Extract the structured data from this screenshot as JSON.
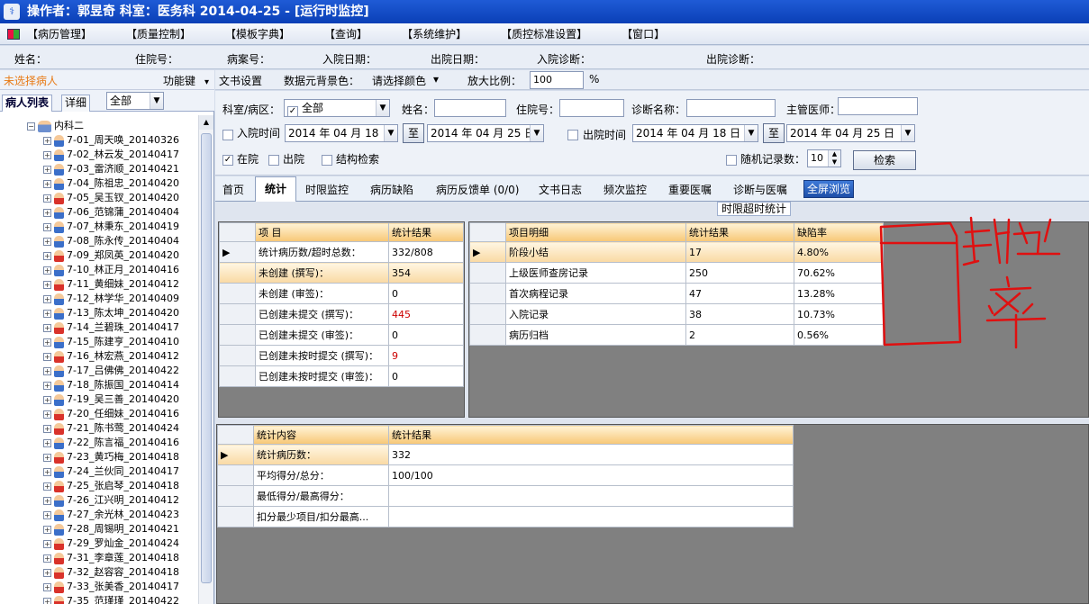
{
  "window": {
    "title": "操作者：郭昱奇    科室：医务科    2014-04-25 - [运行时监控]"
  },
  "menu": {
    "items": [
      "【病历管理】",
      "【质量控制】",
      "【模板字典】",
      "【查询】",
      "【系统维护】",
      "【质控标准设置】",
      "【窗口】"
    ]
  },
  "patient_info": {
    "name": "姓名：",
    "hosp_no": "住院号：",
    "case_no": "病案号：",
    "admit_date": "入院日期：",
    "discharge_date": "出院日期：",
    "admit_diag": "入院诊断：",
    "discharge_diag": "出院诊断："
  },
  "left_panel": {
    "no_patient": "未选择病人",
    "function_key": "功能键",
    "tab_list": "病人列表",
    "tab_detail": "详细",
    "filter_value": "全部",
    "root": "内科二",
    "patients": [
      {
        "label": "7-01_周天唤_20140326",
        "g": "m"
      },
      {
        "label": "7-02_林云发_20140417",
        "g": "m"
      },
      {
        "label": "7-03_雷济顺_20140421",
        "g": "m"
      },
      {
        "label": "7-04_陈祖忠_20140420",
        "g": "m"
      },
      {
        "label": "7-05_吴玉钗_20140420",
        "g": "f"
      },
      {
        "label": "7-06_范锦蒲_20140404",
        "g": "m"
      },
      {
        "label": "7-07_林秉东_20140419",
        "g": "m"
      },
      {
        "label": "7-08_陈永传_20140404",
        "g": "m"
      },
      {
        "label": "7-09_郑凤英_20140420",
        "g": "f"
      },
      {
        "label": "7-10_林正月_20140416",
        "g": "m"
      },
      {
        "label": "7-11_黄细妹_20140412",
        "g": "f"
      },
      {
        "label": "7-12_林学华_20140409",
        "g": "m"
      },
      {
        "label": "7-13_陈太坤_20140420",
        "g": "m"
      },
      {
        "label": "7-14_兰碧珠_20140417",
        "g": "f"
      },
      {
        "label": "7-15_陈建亨_20140410",
        "g": "m"
      },
      {
        "label": "7-16_林宏燕_20140412",
        "g": "f"
      },
      {
        "label": "7-17_吕佛佛_20140422",
        "g": "m"
      },
      {
        "label": "7-18_陈振国_20140414",
        "g": "m"
      },
      {
        "label": "7-19_吴三善_20140420",
        "g": "m"
      },
      {
        "label": "7-20_任细妹_20140416",
        "g": "f"
      },
      {
        "label": "7-21_陈书莺_20140424",
        "g": "f"
      },
      {
        "label": "7-22_陈言福_20140416",
        "g": "m"
      },
      {
        "label": "7-23_黄巧梅_20140418",
        "g": "f"
      },
      {
        "label": "7-24_兰伙同_20140417",
        "g": "m"
      },
      {
        "label": "7-25_张启琴_20140418",
        "g": "f"
      },
      {
        "label": "7-26_江兴明_20140412",
        "g": "m"
      },
      {
        "label": "7-27_余光林_20140423",
        "g": "m"
      },
      {
        "label": "7-28_周锡明_20140421",
        "g": "m"
      },
      {
        "label": "7-29_罗灿金_20140424",
        "g": "f"
      },
      {
        "label": "7-31_李章莲_20140418",
        "g": "f"
      },
      {
        "label": "7-32_赵容容_20140418",
        "g": "f"
      },
      {
        "label": "7-33_张美香_20140417",
        "g": "f"
      },
      {
        "label": "7-35_范瑾瑾_20140422",
        "g": "f"
      }
    ]
  },
  "toolbar": {
    "doc_settings": "文书设置",
    "bg_color_label": "数据元背景色：",
    "bg_color_value": "请选择颜色",
    "zoom_label": "放大比例：",
    "zoom_value": "100",
    "zoom_unit": "%"
  },
  "filter": {
    "dept_label": "科室/病区：",
    "dept_value": "全部",
    "name_label": "姓名：",
    "hosp_no_label": "住院号：",
    "diag_label": "诊断名称：",
    "doctor_label": "主管医师：",
    "admit_time_label": "入院时间",
    "admit_from": "2014 年 04 月 18 日",
    "to1": "至",
    "admit_to": "2014 年 04 月 25 日",
    "discharge_time_label": "出院时间",
    "discharge_from": "2014 年 04 月 18 日",
    "to2": "至",
    "discharge_to": "2014 年 04 月 25 日",
    "in_hosp": "在院",
    "out_hosp": "出院",
    "struct_search": "结构检索",
    "random_label": "随机记录数：",
    "random_value": "10",
    "search_button": "检索"
  },
  "tabs": [
    "首页",
    "统计",
    "时限监控",
    "病历缺陷",
    "病历反馈单 (0/0)",
    "文书日志",
    "频次监控",
    "重要医嘱",
    "诊断与医嘱",
    "全屏浏览"
  ],
  "section": {
    "title": "时限超时统计"
  },
  "grid1": {
    "headers": [
      "项  目",
      "统计结果"
    ],
    "rows": [
      [
        "统计病历数/超时总数：",
        "332/808"
      ],
      [
        "未创建 (撰写)：",
        "354"
      ],
      [
        "未创建 (审签)：",
        "0"
      ],
      [
        "已创建未提交 (撰写)：",
        "445"
      ],
      [
        "已创建未提交 (审签)：",
        "0"
      ],
      [
        "已创建未按时提交 (撰写)：",
        "9"
      ],
      [
        "已创建未按时提交 (审签)：",
        "0"
      ]
    ]
  },
  "grid2": {
    "headers": [
      "项目明细",
      "统计结果",
      "缺陷率"
    ],
    "rows": [
      [
        "阶段小结",
        "17",
        "4.80%"
      ],
      [
        "上级医师查房记录",
        "250",
        "70.62%"
      ],
      [
        "首次病程记录",
        "47",
        "13.28%"
      ],
      [
        "入院记录",
        "38",
        "10.73%"
      ],
      [
        "病历归档",
        "2",
        "0.56%"
      ]
    ]
  },
  "grid3": {
    "headers": [
      "统计内容",
      "统计结果"
    ],
    "rows": [
      [
        "统计病历数：",
        "332"
      ],
      [
        "平均得分/总分：",
        "100/100"
      ],
      [
        "最低得分/最高得分：",
        ""
      ],
      [
        "扣分最少项目/扣分最高...",
        ""
      ]
    ]
  },
  "annotation": {
    "color": "#e01010"
  }
}
